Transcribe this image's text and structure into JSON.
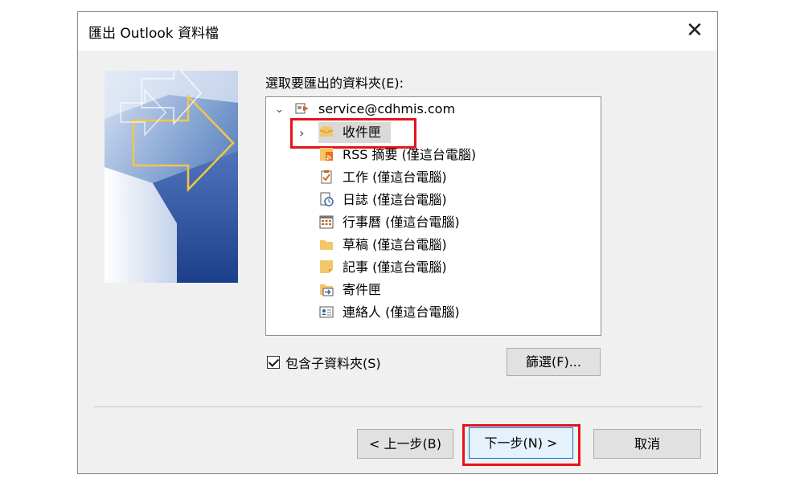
{
  "dialog": {
    "title": "匯出 Outlook 資料檔",
    "close_symbol": "✕"
  },
  "tree": {
    "label": "選取要匯出的資料夾(E):",
    "account": "service@cdhmis.com",
    "items": [
      {
        "label": "收件匣",
        "icon": "inbox-icon"
      },
      {
        "label": "RSS 摘要 (僅這台電腦)",
        "icon": "rss-icon"
      },
      {
        "label": "工作 (僅這台電腦)",
        "icon": "tasks-icon"
      },
      {
        "label": "日誌 (僅這台電腦)",
        "icon": "journal-icon"
      },
      {
        "label": "行事曆 (僅這台電腦)",
        "icon": "calendar-icon"
      },
      {
        "label": "草稿 (僅這台電腦)",
        "icon": "drafts-folder-icon"
      },
      {
        "label": "記事 (僅這台電腦)",
        "icon": "notes-icon"
      },
      {
        "label": "寄件匣",
        "icon": "outbox-icon"
      },
      {
        "label": "連絡人 (僅這台電腦)",
        "icon": "contacts-icon"
      }
    ]
  },
  "options": {
    "include_subfolders": "包含子資料夾(S)",
    "include_subfolders_checked": true,
    "filter_button": "篩選(F)..."
  },
  "footer": {
    "back_button": "< 上一步(B)",
    "next_button": "下一步(N) >",
    "cancel_button": "取消"
  },
  "colors": {
    "highlight": "#e5131b",
    "focus": "#0078d7",
    "dialog_bg": "#f0f0f0"
  }
}
